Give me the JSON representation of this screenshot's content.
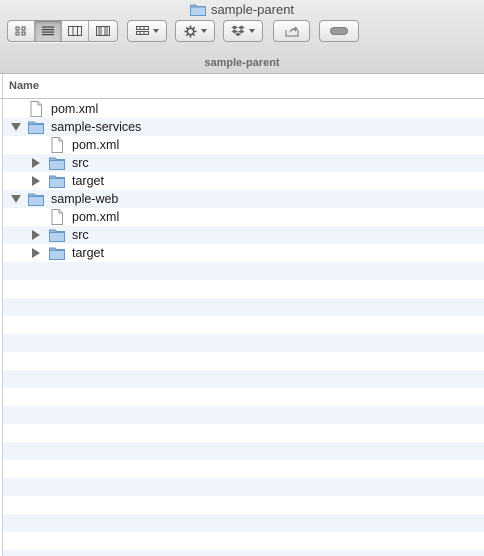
{
  "window": {
    "title": "sample-parent",
    "path_label": "sample-parent"
  },
  "toolbar": {
    "view_modes": [
      "icon-view",
      "list-view",
      "column-view",
      "cover-flow-view"
    ],
    "active_view": "list-view"
  },
  "columns": {
    "name_header": "Name"
  },
  "rows": [
    {
      "label": "pom.xml",
      "kind": "file",
      "depth": 0,
      "disclosure": "none"
    },
    {
      "label": "sample-services",
      "kind": "folder",
      "depth": 0,
      "disclosure": "open"
    },
    {
      "label": "pom.xml",
      "kind": "file",
      "depth": 1,
      "disclosure": "none"
    },
    {
      "label": "src",
      "kind": "folder",
      "depth": 1,
      "disclosure": "closed"
    },
    {
      "label": "target",
      "kind": "folder",
      "depth": 1,
      "disclosure": "closed"
    },
    {
      "label": "sample-web",
      "kind": "folder",
      "depth": 0,
      "disclosure": "open"
    },
    {
      "label": "pom.xml",
      "kind": "file",
      "depth": 1,
      "disclosure": "none"
    },
    {
      "label": "src",
      "kind": "folder",
      "depth": 1,
      "disclosure": "closed"
    },
    {
      "label": "target",
      "kind": "folder",
      "depth": 1,
      "disclosure": "closed"
    }
  ],
  "colors": {
    "stripe": "#f0f4fb",
    "folder": "#8fb9e0",
    "header_text": "#555555"
  }
}
